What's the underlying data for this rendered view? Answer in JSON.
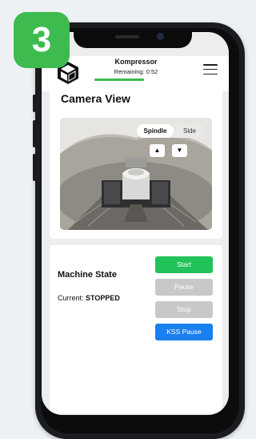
{
  "step": {
    "number": "3",
    "color": "#3dbb4f"
  },
  "header": {
    "title": "Kompressor",
    "remaining": "Remaining: 0:52",
    "progress_color": "#3dbb4f",
    "logo_icon": "cube-logo-icon",
    "menu_icon": "hamburger-menu-icon"
  },
  "camera": {
    "title": "Camera View",
    "toggle": {
      "options": [
        "Spindle",
        "Side"
      ],
      "selected": "Spindle"
    },
    "arrows": {
      "up": "▲",
      "down": "▼"
    }
  },
  "machine": {
    "title": "Machine State",
    "current_label": "Current:",
    "current_value": "STOPPED",
    "buttons": {
      "start": "Start",
      "pause": "Pause",
      "stop": "Stop",
      "kss_pause": "KSS Pause"
    },
    "colors": {
      "start": "#22c25a",
      "disabled": "#c8c8c8",
      "kss": "#1a80f0"
    }
  }
}
